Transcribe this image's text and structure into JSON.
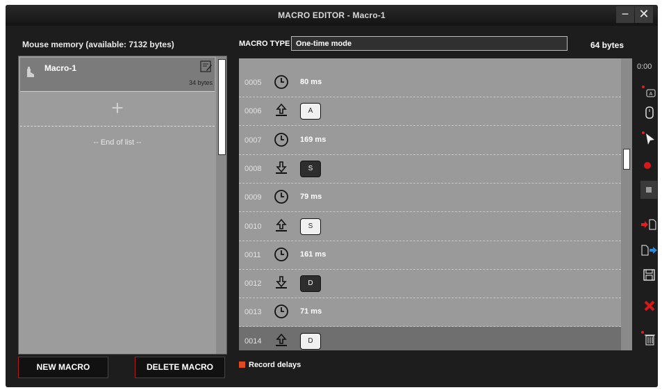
{
  "window": {
    "title": "MACRO EDITOR - Macro-1",
    "minimize_label": "−",
    "close_label": "✕"
  },
  "left": {
    "memory_label": "Mouse memory (available: 7132 bytes)",
    "macros": [
      {
        "name": "Macro-1",
        "size": "34 bytes"
      }
    ],
    "add_label": "+",
    "end_of_list": "-- End of list --",
    "new_macro_label": "NEW MACRO",
    "delete_macro_label": "DELETE MACRO"
  },
  "header": {
    "macro_type_label": "MACRO TYPE",
    "macro_type_value": "One-time mode",
    "bytes": "64 bytes"
  },
  "rows": [
    {
      "index": "0005",
      "type": "delay",
      "value": "80 ms"
    },
    {
      "index": "0006",
      "type": "key-up",
      "value": "A"
    },
    {
      "index": "0007",
      "type": "delay",
      "value": "169 ms"
    },
    {
      "index": "0008",
      "type": "key-down",
      "value": "S"
    },
    {
      "index": "0009",
      "type": "delay",
      "value": "79 ms"
    },
    {
      "index": "0010",
      "type": "key-up",
      "value": "S"
    },
    {
      "index": "0011",
      "type": "delay",
      "value": "161 ms"
    },
    {
      "index": "0012",
      "type": "key-down",
      "value": "D"
    },
    {
      "index": "0013",
      "type": "delay",
      "value": "71 ms"
    },
    {
      "index": "0014",
      "type": "key-up",
      "value": "D",
      "selected": true
    }
  ],
  "toolbar": {
    "timer": "0:00",
    "tools": [
      "keyboard-key-icon",
      "mouse-icon",
      "cursor-icon",
      "record-icon",
      "stop-icon",
      "import-icon",
      "export-icon",
      "save-icon",
      "delete-x-icon",
      "trash-icon"
    ]
  },
  "footer": {
    "record_delays_label": "Record delays"
  },
  "colors": {
    "accent_red": "#e04a20",
    "button_border": "#b01818",
    "export_blue": "#2b8ad8"
  }
}
